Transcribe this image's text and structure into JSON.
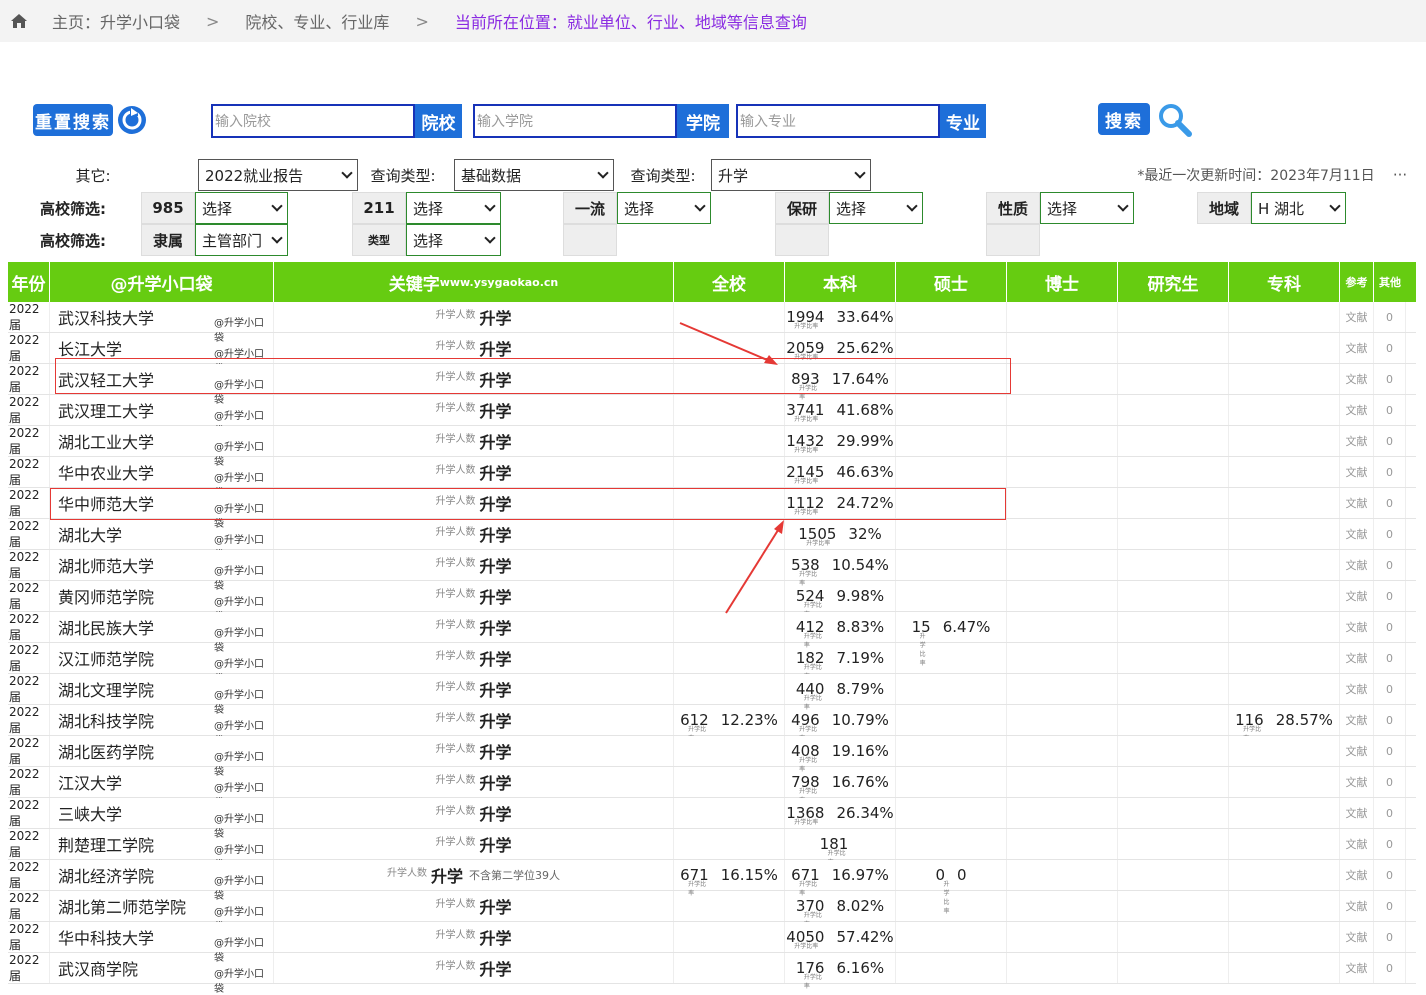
{
  "breadcrumb": {
    "home": "主页：升学小口袋",
    "sep": ">",
    "library": "院校、专业、行业库",
    "current": "当前所在位置：就业单位、行业、地域等信息查询"
  },
  "search": {
    "reset_label": "重置搜索",
    "school_placeholder": "输入院校",
    "school_tag": "院校",
    "college_placeholder": "输入学院",
    "college_tag": "学院",
    "major_placeholder": "输入专业",
    "major_tag": "专业",
    "search_label": "搜索"
  },
  "filters": {
    "other_label": "其它:",
    "report_value": "2022就业报告",
    "query_type_label": "查询类型:",
    "query_type_value": "基础数据",
    "query_type2_label": "查询类型:",
    "query_type2_value": "升学",
    "updated": "*最近一次更新时间：2023年7月11日",
    "more": "···",
    "filter1_label": "高校筛选:",
    "filter2_label": "高校筛选:",
    "f985": "985",
    "f985_value": "选择",
    "f211": "211",
    "f211_value": "选择",
    "first_class": "一流",
    "first_class_value": "选择",
    "baoyan": "保研",
    "baoyan_value": "选择",
    "nature": "性质",
    "nature_value": "选择",
    "region": "地域",
    "region_value": "H 湖北",
    "affiliation": "隶属",
    "affiliation_value": "主管部门",
    "type": "类型",
    "type_value": "选择"
  },
  "table": {
    "headers": {
      "year": "年份",
      "school": "@升学小口袋",
      "keyword": "关键字",
      "keyword_sub": "www.ysygaokao.cn",
      "all": "全校",
      "bachelor": "本科",
      "master": "硕士",
      "phd": "博士",
      "graduate": "研究生",
      "junior": "专科",
      "ref": "参考",
      "other": "其他"
    },
    "watermark": "@升学小口袋",
    "key_small": "升学人数",
    "key_big": "升学",
    "ref_text": "文献",
    "other_text": "0",
    "sub_label": "升学比率",
    "rows": [
      {
        "year": "2022届",
        "school": "武汉科技大学",
        "all": [
          "",
          ""
        ],
        "bachelor": [
          "1994",
          "33.64%"
        ],
        "master": [
          "",
          ""
        ],
        "junior": [
          "",
          ""
        ],
        "note": ""
      },
      {
        "year": "2022届",
        "school": "长江大学",
        "all": [
          "",
          ""
        ],
        "bachelor": [
          "2059",
          "25.62%"
        ],
        "master": [
          "",
          ""
        ],
        "junior": [
          "",
          ""
        ],
        "note": ""
      },
      {
        "year": "2022届",
        "school": "武汉轻工大学",
        "all": [
          "",
          ""
        ],
        "bachelor": [
          "893",
          "17.64%"
        ],
        "master": [
          "",
          ""
        ],
        "junior": [
          "",
          ""
        ],
        "note": ""
      },
      {
        "year": "2022届",
        "school": "武汉理工大学",
        "all": [
          "",
          ""
        ],
        "bachelor": [
          "3741",
          "41.68%"
        ],
        "master": [
          "",
          ""
        ],
        "junior": [
          "",
          ""
        ],
        "note": ""
      },
      {
        "year": "2022届",
        "school": "湖北工业大学",
        "all": [
          "",
          ""
        ],
        "bachelor": [
          "1432",
          "29.99%"
        ],
        "master": [
          "",
          ""
        ],
        "junior": [
          "",
          ""
        ],
        "note": ""
      },
      {
        "year": "2022届",
        "school": "华中农业大学",
        "all": [
          "",
          ""
        ],
        "bachelor": [
          "2145",
          "46.63%"
        ],
        "master": [
          "",
          ""
        ],
        "junior": [
          "",
          ""
        ],
        "note": ""
      },
      {
        "year": "2022届",
        "school": "华中师范大学",
        "all": [
          "",
          ""
        ],
        "bachelor": [
          "1112",
          "24.72%"
        ],
        "master": [
          "",
          ""
        ],
        "junior": [
          "",
          ""
        ],
        "note": ""
      },
      {
        "year": "2022届",
        "school": "湖北大学",
        "all": [
          "",
          ""
        ],
        "bachelor": [
          "1505",
          "32%"
        ],
        "master": [
          "",
          ""
        ],
        "junior": [
          "",
          ""
        ],
        "note": ""
      },
      {
        "year": "2022届",
        "school": "湖北师范大学",
        "all": [
          "",
          ""
        ],
        "bachelor": [
          "538",
          "10.54%"
        ],
        "master": [
          "",
          ""
        ],
        "junior": [
          "",
          ""
        ],
        "note": ""
      },
      {
        "year": "2022届",
        "school": "黄冈师范学院",
        "all": [
          "",
          ""
        ],
        "bachelor": [
          "524",
          "9.98%"
        ],
        "master": [
          "",
          ""
        ],
        "junior": [
          "",
          ""
        ],
        "note": ""
      },
      {
        "year": "2022届",
        "school": "湖北民族大学",
        "all": [
          "",
          ""
        ],
        "bachelor": [
          "412",
          "8.83%"
        ],
        "master": [
          "15",
          "6.47%"
        ],
        "junior": [
          "",
          ""
        ],
        "note": ""
      },
      {
        "year": "2022届",
        "school": "汉江师范学院",
        "all": [
          "",
          ""
        ],
        "bachelor": [
          "182",
          "7.19%"
        ],
        "master": [
          "",
          ""
        ],
        "junior": [
          "",
          ""
        ],
        "note": ""
      },
      {
        "year": "2022届",
        "school": "湖北文理学院",
        "all": [
          "",
          ""
        ],
        "bachelor": [
          "440",
          "8.79%"
        ],
        "master": [
          "",
          ""
        ],
        "junior": [
          "",
          ""
        ],
        "note": ""
      },
      {
        "year": "2022届",
        "school": "湖北科技学院",
        "all": [
          "612",
          "12.23%"
        ],
        "bachelor": [
          "496",
          "10.79%"
        ],
        "master": [
          "",
          ""
        ],
        "junior": [
          "116",
          "28.57%"
        ],
        "note": ""
      },
      {
        "year": "2022届",
        "school": "湖北医药学院",
        "all": [
          "",
          ""
        ],
        "bachelor": [
          "408",
          "19.16%"
        ],
        "master": [
          "",
          ""
        ],
        "junior": [
          "",
          ""
        ],
        "note": ""
      },
      {
        "year": "2022届",
        "school": "江汉大学",
        "all": [
          "",
          ""
        ],
        "bachelor": [
          "798",
          "16.76%"
        ],
        "master": [
          "",
          ""
        ],
        "junior": [
          "",
          ""
        ],
        "note": ""
      },
      {
        "year": "2022届",
        "school": "三峡大学",
        "all": [
          "",
          ""
        ],
        "bachelor": [
          "1368",
          "26.34%"
        ],
        "master": [
          "",
          ""
        ],
        "junior": [
          "",
          ""
        ],
        "note": ""
      },
      {
        "year": "2022届",
        "school": "荆楚理工学院",
        "all": [
          "",
          ""
        ],
        "bachelor": [
          "181",
          ""
        ],
        "master": [
          "",
          ""
        ],
        "junior": [
          "",
          ""
        ],
        "note": ""
      },
      {
        "year": "2022届",
        "school": "湖北经济学院",
        "all": [
          "671",
          "16.15%"
        ],
        "bachelor": [
          "671",
          "16.97%"
        ],
        "master": [
          "0",
          "0"
        ],
        "junior": [
          "",
          ""
        ],
        "note": "不含第二学位39人"
      },
      {
        "year": "2022届",
        "school": "湖北第二师范学院",
        "all": [
          "",
          ""
        ],
        "bachelor": [
          "370",
          "8.02%"
        ],
        "master": [
          "",
          ""
        ],
        "junior": [
          "",
          ""
        ],
        "note": ""
      },
      {
        "year": "2022届",
        "school": "华中科技大学",
        "all": [
          "",
          ""
        ],
        "bachelor": [
          "4050",
          "57.42%"
        ],
        "master": [
          "",
          ""
        ],
        "junior": [
          "",
          ""
        ],
        "note": ""
      },
      {
        "year": "2022届",
        "school": "武汉商学院",
        "all": [
          "",
          ""
        ],
        "bachelor": [
          "176",
          "6.16%"
        ],
        "master": [
          "",
          ""
        ],
        "junior": [
          "",
          ""
        ],
        "note": ""
      }
    ]
  },
  "colors": {
    "header_green": "#66cc11",
    "button_blue": "#1e6fd9",
    "highlight_red": "#e53935",
    "breadcrumb_current": "#8a2be2"
  }
}
